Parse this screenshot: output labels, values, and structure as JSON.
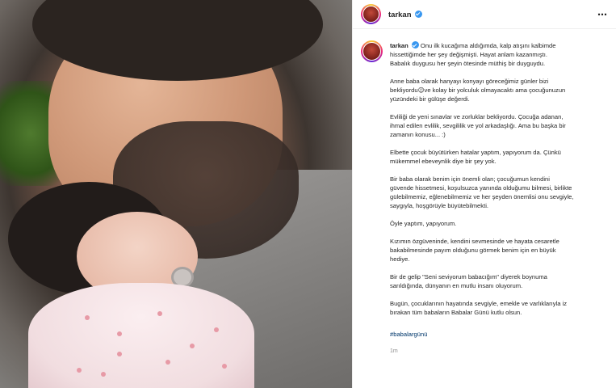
{
  "post": {
    "username": "tarkan",
    "caption_username": "tarkan",
    "more_icon": "⋯",
    "paragraphs": [
      "Onu ilk kucağıma aldığımda, kalp atışını kalbimde\nhissettiğimde her şey değişmişti. Hayat anlam kazanmıştı.\nBabalık duygusu her şeyin ötesinde müthiş bir duyguydu.",
      "Anne baba olarak hanyayı konyayı göreceğimiz günler bizi\nbekliyordu😉ve kolay bir yolculuk olmayacaktı ama çocuğunuzun\nyüzündeki bir gülüşe değerdi.",
      "Evliliği de yeni sınavlar ve zorluklar bekliyordu. Çocuğa adanan,\nihmal edilen evlilik, sevgililik ve yol arkadaşlığı. Ama bu başka bir\nzamanın konusu... :)",
      "Elbette çocuk büyütürken hatalar yaptım, yapıyorum da. Çünkü\nmükemmel ebeveynlik diye bir şey yok.",
      "Bir baba olarak benim için önemli olan; çocuğumun kendini\ngüvende hissetmesi, koşulsuzca yanında olduğumu bilmesi, birlikte\ngülebilmemiz, eğlenebilmemiz ve her şeyden önemlisi onu sevgiyle,\nsaygıyla, hoşgörüyle büyütebilmekti.",
      "Öyle yaptım, yapıyorum.",
      "Kızımın özgüveninde, kendini sevmesinde ve hayata cesaretle\nbakabilmesinde payım olduğunu görmek benim için en büyük\nhediye.",
      "Bir de gelip \"Seni seviyorum babacığım\" diyerek boynuma\nsarıldığında, dünyanın en mutlu insanı oluyorum.",
      "Bugün, çocuklarının hayatında sevgiyle, emekle ve varlıklarıyla iz\nbırakan tüm babaların Babalar Günü kutlu olsun."
    ],
    "hashtag": "#babalargünü",
    "timestamp": "1m"
  },
  "colors": {
    "verified": "#3897f0",
    "hashtag": "#00376b",
    "meta": "#8e8e8e"
  }
}
